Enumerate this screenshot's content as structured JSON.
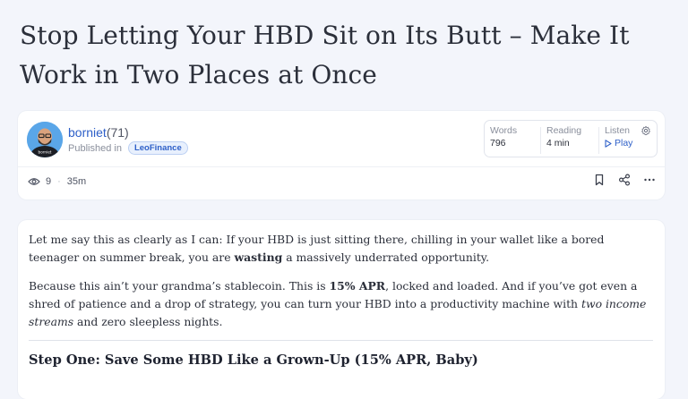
{
  "post": {
    "title": "Stop Letting Your HBD Sit on Its Butt – Make It Work in Two Places at Once"
  },
  "author": {
    "name": "borniet",
    "reputation": "(71)",
    "published_label": "Published in",
    "community": "LeoFinance",
    "avatar_caption": "borniet"
  },
  "stats": {
    "words_label": "Words",
    "words_value": "796",
    "reading_label": "Reading",
    "reading_value": "4 min",
    "listen_label": "Listen",
    "listen_value": "Play"
  },
  "engagement": {
    "views": "9",
    "age": "35m"
  },
  "content": {
    "p1_a": "Let me say this as clearly as I can: If your HBD is just sitting there, chilling in your wallet like a bored teenager on summer break, you are ",
    "p1_bold": "wasting",
    "p1_b": " a massively underrated opportunity.",
    "p2_a": "Because this ain’t your grandma’s stablecoin. This is ",
    "p2_bold": "15% APR",
    "p2_b": ", locked and loaded. And if you’ve got even a shred of patience and a drop of strategy, you can turn your HBD into a productivity machine with ",
    "p2_italic": "two income streams",
    "p2_c": " and zero sleepless nights.",
    "heading1": "Step One: Save Some HBD Like a Grown-Up (15% APR, Baby)"
  },
  "colors": {
    "accent": "#2d5fc8",
    "page_bg": "#f3f5fb",
    "badge_bg": "#e8f0fd"
  }
}
